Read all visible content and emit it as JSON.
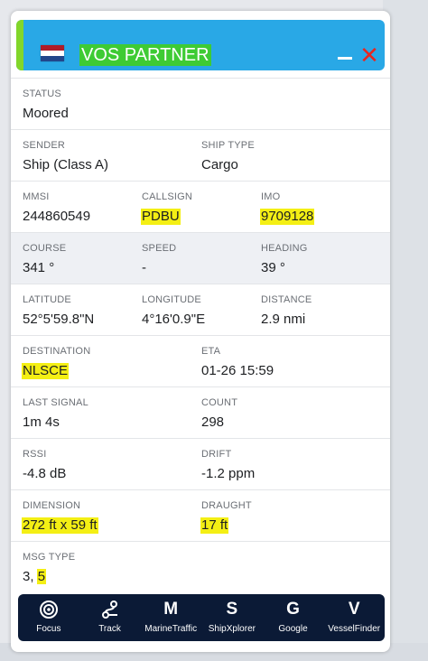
{
  "vessel": {
    "name": "VOS PARTNER",
    "flag_icon": "netherlands-flag-icon",
    "colors": {
      "header": "#29a8e6",
      "accent_stripe": "#82d62a",
      "close": "#e8261f",
      "highlight": "#f4ef14",
      "toolbar": "#0b1a36"
    }
  },
  "fields": {
    "status": {
      "label": "STATUS",
      "value": "Moored"
    },
    "sender": {
      "label": "SENDER",
      "value": "Ship (Class A)"
    },
    "ship_type": {
      "label": "SHIP TYPE",
      "value": "Cargo"
    },
    "mmsi": {
      "label": "MMSI",
      "value": "244860549"
    },
    "callsign": {
      "label": "CALLSIGN",
      "value": "PDBU"
    },
    "imo": {
      "label": "IMO",
      "value": "9709128"
    },
    "course": {
      "label": "COURSE",
      "value": "341 °"
    },
    "speed": {
      "label": "SPEED",
      "value": "-"
    },
    "heading": {
      "label": "HEADING",
      "value": "39 °"
    },
    "latitude": {
      "label": "LATITUDE",
      "value": "52°5'59.8\"N"
    },
    "longitude": {
      "label": "LONGITUDE",
      "value": "4°16'0.9\"E"
    },
    "distance": {
      "label": "DISTANCE",
      "value": "2.9 nmi"
    },
    "destination": {
      "label": "DESTINATION",
      "value": "NLSCE"
    },
    "eta": {
      "label": "ETA",
      "value": "01-26 15:59"
    },
    "last_signal": {
      "label": "LAST SIGNAL",
      "value": "1m 4s"
    },
    "count": {
      "label": "COUNT",
      "value": "298"
    },
    "rssi": {
      "label": "RSSI",
      "value": "-4.8 dB"
    },
    "drift": {
      "label": "DRIFT",
      "value": "-1.2 ppm"
    },
    "dimension": {
      "label": "DIMENSION",
      "value": "272 ft x 59 ft"
    },
    "draught": {
      "label": "DRAUGHT",
      "value": "17 ft"
    },
    "msg_type": {
      "label": "MSG TYPE",
      "value_prefix": "3, ",
      "value_highlight": "5"
    }
  },
  "toolbar": {
    "focus": {
      "label": "Focus",
      "icon": "target-icon"
    },
    "track": {
      "label": "Track",
      "icon": "track-route-icon"
    },
    "marinetraffic": {
      "label": "MarineTraffic",
      "glyph": "M"
    },
    "shipxplorer": {
      "label": "ShipXplorer",
      "glyph": "S"
    },
    "google": {
      "label": "Google",
      "glyph": "G"
    },
    "vesselfinder": {
      "label": "VesselFinder",
      "glyph": "V"
    }
  }
}
